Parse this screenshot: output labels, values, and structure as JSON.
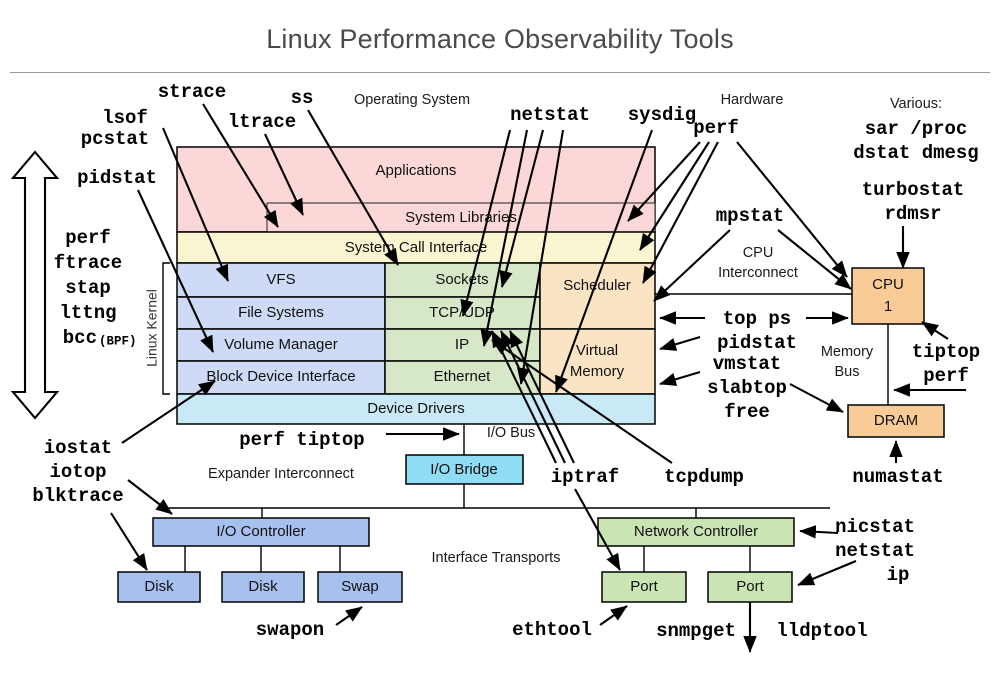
{
  "page": {
    "title": "Linux Performance Observability Tools"
  },
  "section_labels": {
    "operating_system": "Operating System",
    "hardware": "Hardware",
    "various_heading": "Various:",
    "linux_kernel": "Linux Kernel",
    "cpu_interconnect_l1": "CPU",
    "cpu_interconnect_l2": "Interconnect",
    "memory_bus_l1": "Memory",
    "memory_bus_l2": "Bus",
    "io_bus": "I/O Bus",
    "expander_interconnect": "Expander Interconnect",
    "interface_transports": "Interface Transports"
  },
  "stack": {
    "applications": "Applications",
    "system_libraries": "System Libraries",
    "system_call_interface": "System Call Interface",
    "vfs": "VFS",
    "file_systems": "File Systems",
    "volume_manager": "Volume Manager",
    "block_device_interface": "Block Device Interface",
    "sockets": "Sockets",
    "tcp_udp": "TCP/UDP",
    "ip": "IP",
    "ethernet": "Ethernet",
    "scheduler": "Scheduler",
    "virtual_memory_l1": "Virtual",
    "virtual_memory_l2": "Memory",
    "device_drivers": "Device Drivers"
  },
  "hardware_boxes": {
    "cpu_l1": "CPU",
    "cpu_l2": "1",
    "dram": "DRAM",
    "io_bridge": "I/O Bridge",
    "io_controller": "I/O Controller",
    "disk_1": "Disk",
    "disk_2": "Disk",
    "swap": "Swap",
    "network_controller": "Network Controller",
    "port_1": "Port",
    "port_2": "Port"
  },
  "tools": {
    "strace": "strace",
    "ss": "ss",
    "lsof": "lsof",
    "pcstat": "pcstat",
    "ltrace": "ltrace",
    "pidstat": "pidstat",
    "netstat_top": "netstat",
    "sysdig": "sysdig",
    "perf_hw": "perf",
    "mpstat": "mpstat",
    "sar_proc": "sar /proc",
    "dstat_dmesg": "dstat dmesg",
    "turbostat": "turbostat",
    "rdmsr": "rdmsr",
    "kernel_tracers": [
      "perf",
      "ftrace",
      "stap",
      "lttng"
    ],
    "bcc_name": "bcc",
    "bcc_suffix": "(BPF)",
    "top_ps": "top ps",
    "pidstat_cpu": "pidstat",
    "tiptop": "tiptop",
    "perf_cpu": "perf",
    "vmstat": "vmstat",
    "slabtop": "slabtop",
    "free": "free",
    "numastat": "numastat",
    "iostat": "iostat",
    "iotop": "iotop",
    "blktrace": "blktrace",
    "perf_tiptop": "perf tiptop",
    "swapon": "swapon",
    "iptraf": "iptraf",
    "tcpdump": "tcpdump",
    "nicstat": "nicstat",
    "netstat_nic": "netstat",
    "ip": "ip",
    "ethtool": "ethtool",
    "snmpget": "snmpget",
    "lldptool": "lldptool"
  },
  "colors": {
    "applications": "#fbd7d7",
    "syscall": "#fbf6d2",
    "kernel_blue": "#cedaf6",
    "kernel_green": "#d6e8c8",
    "kernel_orange": "#fbe4c4",
    "device_drivers": "#c9e9f7",
    "io_bridge": "#8fdcf5",
    "disk_blue": "#a8c0ee",
    "cpu_orange": "#f9cc97",
    "net_green": "#cbe4b4",
    "stroke": "#000000",
    "title": "#4a4a4a"
  }
}
